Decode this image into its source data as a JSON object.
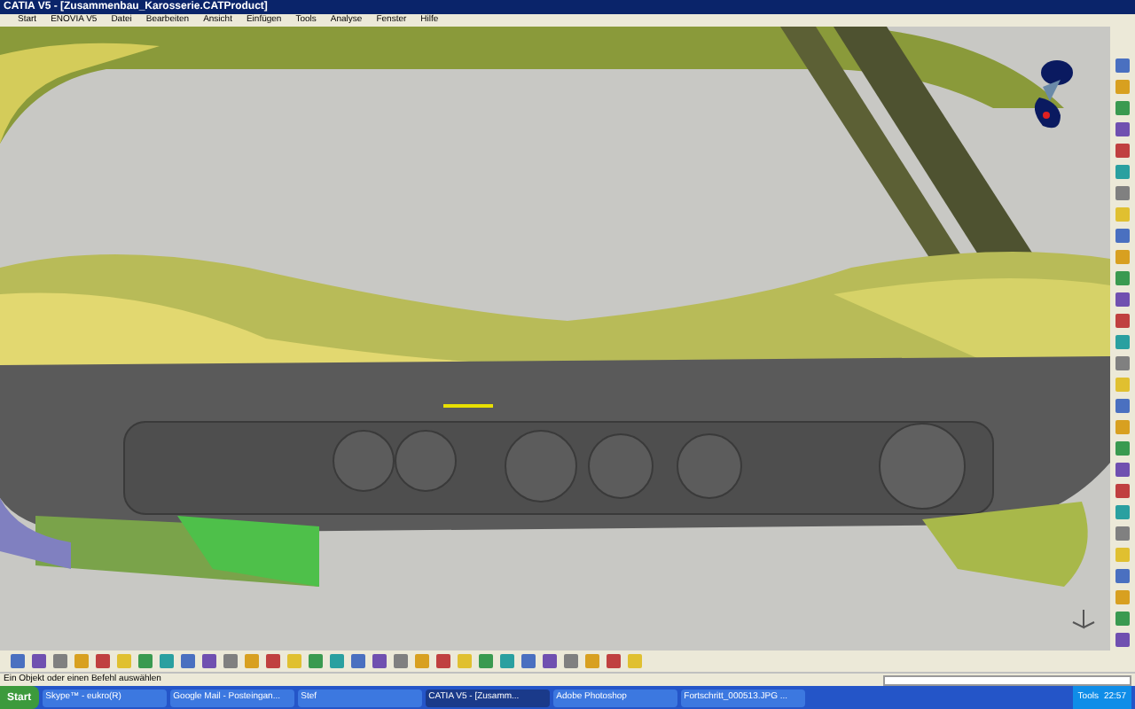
{
  "window": {
    "title": "CATIA V5 - [Zusammenbau_Karosserie.CATProduct]"
  },
  "menu": [
    "Start",
    "ENOVIA V5",
    "Datei",
    "Bearbeiten",
    "Ansicht",
    "Einfügen",
    "Tools",
    "Analyse",
    "Fenster",
    "Hilfe"
  ],
  "status_bar": {
    "message": "Ein Objekt oder einen Befehl auswählen"
  },
  "taskbar": {
    "start": "Start",
    "tasks": [
      {
        "label": "Skype™ - eukro(R)",
        "selected": false
      },
      {
        "label": "Google Mail - Posteingan...",
        "selected": false
      },
      {
        "label": "Stef",
        "selected": false
      },
      {
        "label": "CATIA V5 - [Zusamm...",
        "selected": true
      },
      {
        "label": "Adobe Photoshop",
        "selected": false
      },
      {
        "label": "Fortschritt_000513.JPG ...",
        "selected": false
      }
    ],
    "tray_label": "Tools",
    "clock": "22:57"
  }
}
